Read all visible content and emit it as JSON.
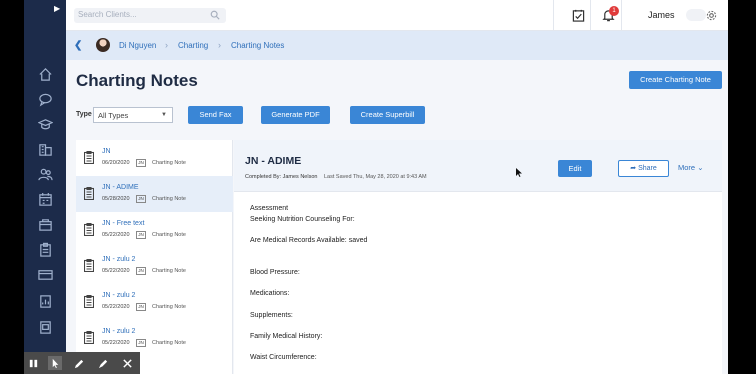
{
  "search": {
    "placeholder": "Search Clients..."
  },
  "topbar": {
    "notification_count": "1",
    "username": "James"
  },
  "breadcrumb": {
    "client": "Di Nguyen",
    "section": "Charting",
    "current": "Charting Notes"
  },
  "page": {
    "title": "Charting Notes",
    "create_button": "Create Charting Note"
  },
  "filters": {
    "type_label": "Type",
    "type_value": "All Types",
    "send_fax": "Send Fax",
    "generate_pdf": "Generate PDF",
    "create_superbill": "Create Superbill"
  },
  "notes": [
    {
      "title": "JN",
      "date": "06/20/2020",
      "tag": "JN",
      "kind": "Charting Note"
    },
    {
      "title": "JN - ADIME",
      "date": "05/28/2020",
      "tag": "JN",
      "kind": "Charting Note"
    },
    {
      "title": "JN - Free text",
      "date": "05/22/2020",
      "tag": "JN",
      "kind": "Charting Note"
    },
    {
      "title": "JN - zulu 2",
      "date": "05/22/2020",
      "tag": "JN",
      "kind": "Charting Note"
    },
    {
      "title": "JN - zulu 2",
      "date": "05/22/2020",
      "tag": "JN",
      "kind": "Charting Note"
    },
    {
      "title": "JN - zulu 2",
      "date": "05/22/2020",
      "tag": "JN",
      "kind": "Charting Note"
    }
  ],
  "detail": {
    "title": "JN - ADIME",
    "completed_by": "Completed By: James Nelson",
    "last_saved": "Last Saved Thu, May 28, 2020 at 9:43 AM",
    "edit": "Edit",
    "share": "Share",
    "more": "More",
    "fields": [
      "Assessment",
      "Seeking Nutrition Counseling For:",
      "Are Medical Records Available: saved",
      "Blood Pressure:",
      "Medications:",
      "Supplements:",
      "Family Medical History:",
      "Waist Circumference:"
    ]
  },
  "colors": {
    "accent": "#3a86d6",
    "sidebar": "#1c2b4a",
    "badge": "#e03b3b"
  }
}
